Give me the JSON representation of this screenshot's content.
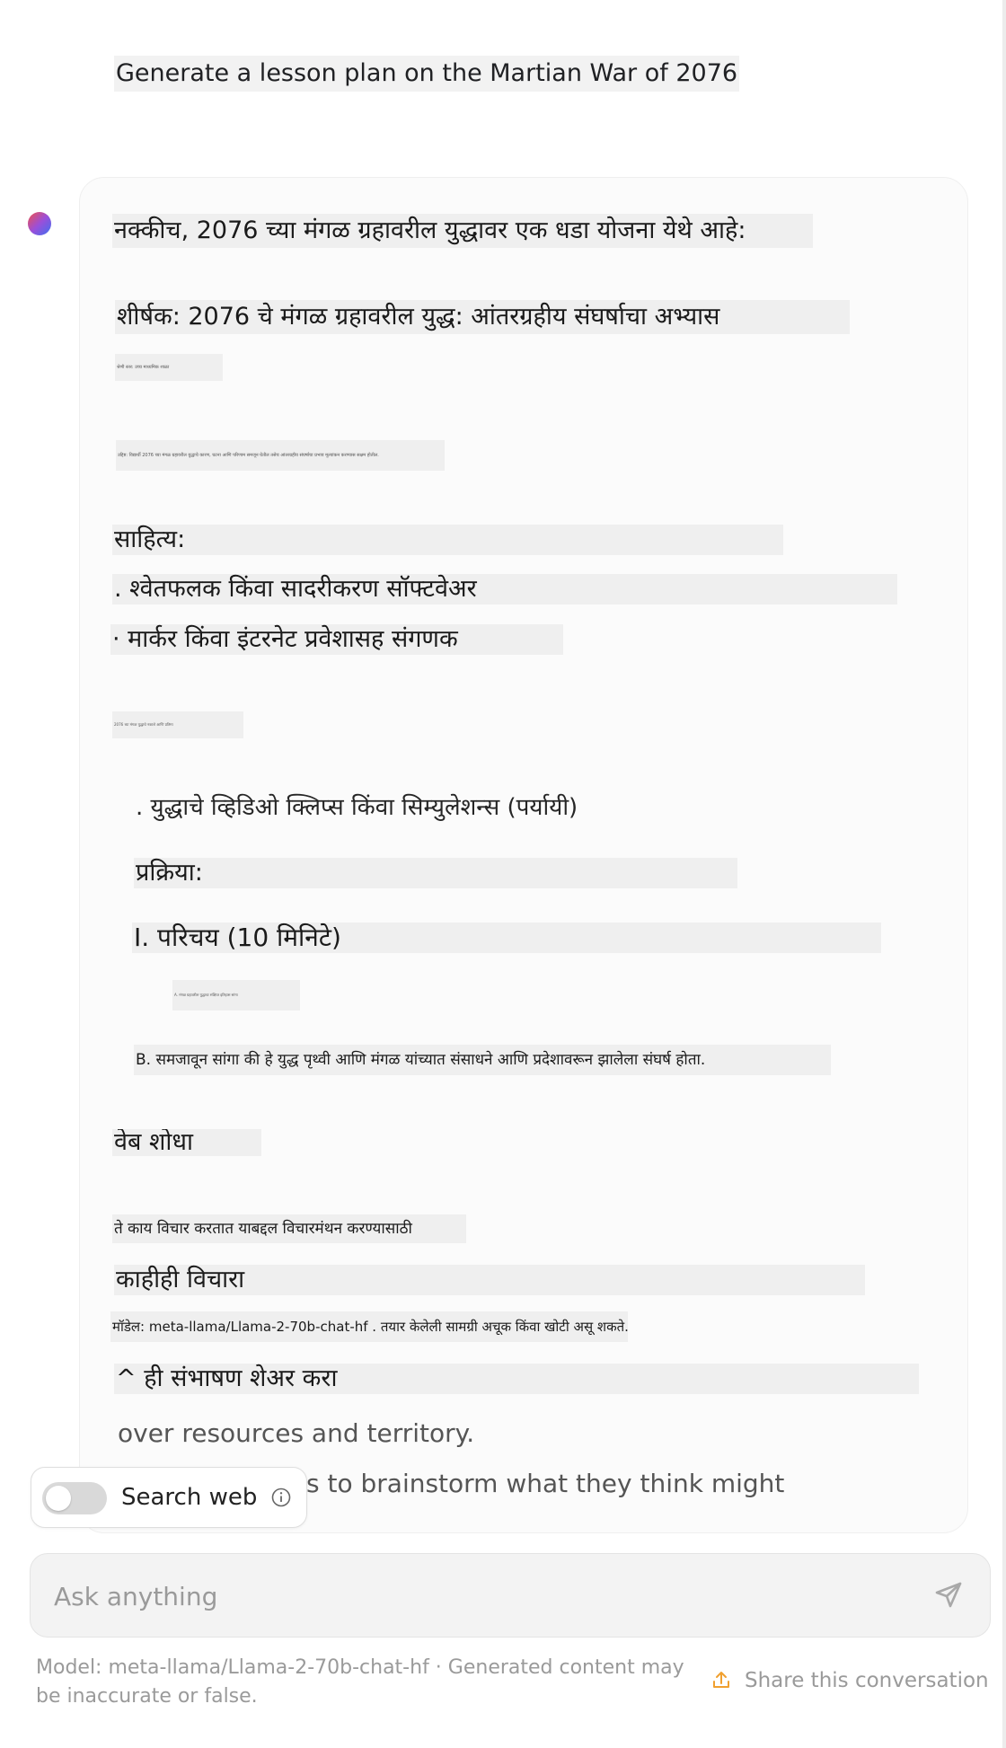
{
  "user_message": "Generate a lesson plan on the Martian War of 2076",
  "assistant": {
    "lines": [
      "नक्कीच, 2076 च्या मंगळ ग्रहावरील युद्धावर एक धडा योजना येथे आहे:",
      "शीर्षक: 2076 चे मंगळ ग्रहावरील युद्ध: आंतरग्रहीय संघर्षाचा अभ्यास",
      "श्रेणी स्तर: उच्च माध्यमिक शाळा",
      "उद्दिष्ट: विद्यार्थी 2076 च्या मंगळ ग्रहावरील युद्धाचे कारण, घटना आणि परिणाम समजून घेतील तसेच आंतरग्रहीय संघर्षाचा प्रभाव मूल्यांकन करण्यास सक्षम होतील.",
      "साहित्य:",
      ". श्वेतफलक किंवा सादरीकरण सॉफ्टवेअर",
      "· मार्कर किंवा इंटरनेट प्रवेशासह संगणक",
      "2076 च्या मंगळ युद्धाचे नकाशे आणि प्रतिमा",
      ". युद्धाचे व्हिडिओ क्लिप्स किंवा सिम्युलेशन्स (पर्यायी)",
      "प्रक्रिया:",
      "I. परिचय (10 मिनिटे)",
      "A. मंगळ ग्रहावरील युद्धाचा संक्षिप्त इतिहास सांगा",
      "B. समजावून सांगा की हे युद्ध पृथ्वी आणि मंगळ यांच्यात संसाधने आणि प्रदेशावरून झालेला संघर्ष होता.",
      "वेब शोधा",
      "ते काय विचार करतात याबद्दल विचारमंथन करण्यासाठी",
      "काहीही विचारा",
      "मॉडेल: meta-llama/Llama-2-70b-chat-hf . तयार केलेली सामग्री अचूक किंवा खोटी असू शकते.",
      "^ ही संभाषण शेअर करा",
      "over resources and territory.",
      "s to brainstorm what they think might"
    ]
  },
  "search_toggle": {
    "label": "Search web",
    "enabled": false
  },
  "input": {
    "placeholder": "Ask anything",
    "value": ""
  },
  "footer": {
    "note": "Model: meta-llama/Llama-2-70b-chat-hf · Generated content may be inaccurate or false.",
    "share_label": "Share this conversation"
  },
  "icons": {
    "assistant_avatar": "gradient-orb-avatar",
    "info": "info-circle-icon",
    "send": "paper-plane-icon",
    "share": "upload-arrow-icon"
  },
  "colors": {
    "accent_orange": "#f0a030",
    "placeholder_gray": "#9a9a9a",
    "highlight_gray": "#efefef"
  }
}
